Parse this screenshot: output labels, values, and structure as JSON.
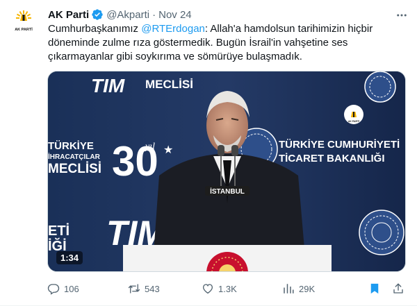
{
  "author": {
    "name": "AK Parti",
    "handle": "@Akparti",
    "date": "Nov 24",
    "avatar_label": "AK PARTİ"
  },
  "tweet": {
    "text_before": "Cumhurbaşkanımız ",
    "mention": "@RTErdogan",
    "text_after": ": Allah'a hamdolsun tarihimizin hiçbir döneminde zulme rıza göstermedik. Bugün İsrail'in vahşetine ses çıkarmayanlar gibi soykırıma ve sömürüye bulaşmadık."
  },
  "media": {
    "duration": "1:34",
    "backdrop_left_1": "TÜRKİYE",
    "backdrop_left_2": "İHRACATÇILAR",
    "backdrop_left_3": "MECLİSİ",
    "backdrop_top": "MECLİSİ",
    "backdrop_logo": "30",
    "backdrop_logo_sub": "yıl",
    "backdrop_right_1": "TÜRKİYE CUMHURİYETİ",
    "backdrop_right_2": "TİCARET BAKANLIĞI",
    "backdrop_bottom_left_1": "ETİ",
    "backdrop_bottom_left_2": "İĞİ",
    "podium_sign": "İSTANBUL",
    "watermark": "AK PARTİ"
  },
  "actions": {
    "replies": "106",
    "reposts": "543",
    "likes": "1.3K",
    "views": "29K"
  },
  "colors": {
    "accent": "#1d9bf0",
    "muted": "#536471",
    "bookmark": "#1d9bf0",
    "party_yellow": "#f7b500"
  }
}
